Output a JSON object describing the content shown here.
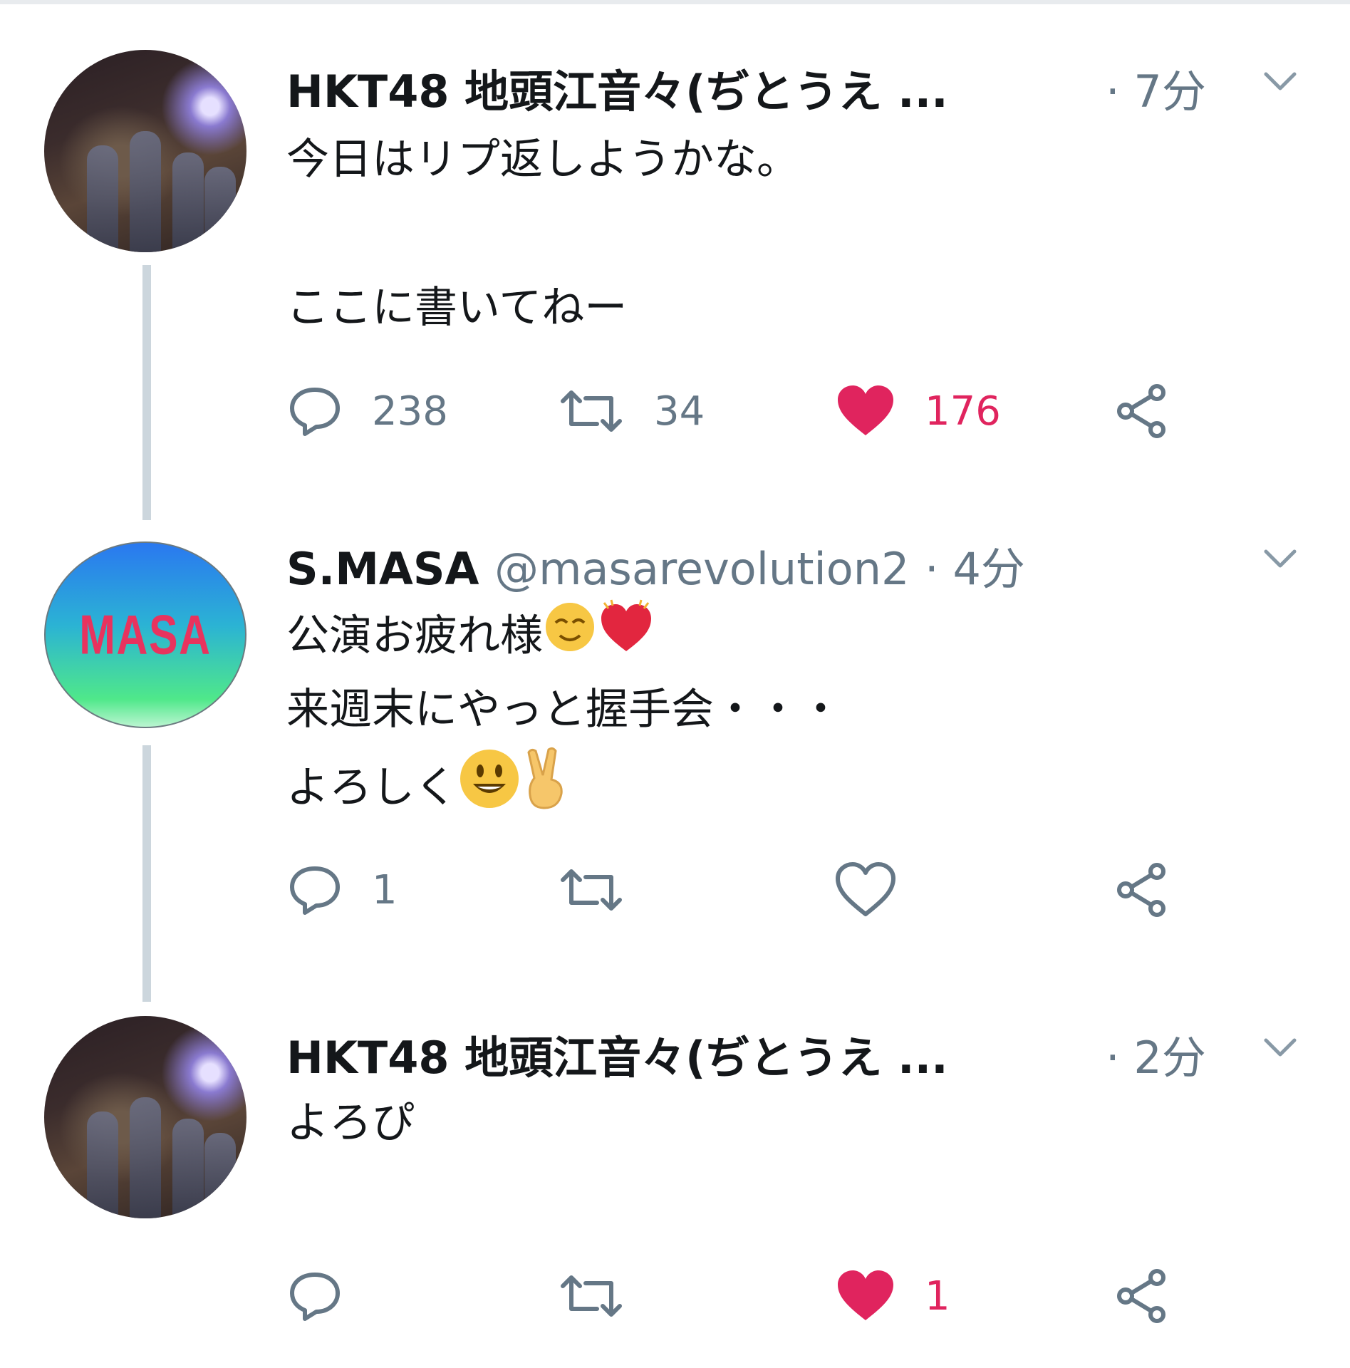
{
  "tweets": [
    {
      "name": "HKT48 地頭江音々(ぢとうえ ...",
      "handle": "",
      "time": "· 7分",
      "body": [
        "今日はリプ返しようかな。",
        "",
        "ここに書いてねー"
      ],
      "reply_count": "238",
      "retweet_count": "34",
      "like_count": "176",
      "liked": true
    },
    {
      "name": "S.MASA",
      "handle": "@masarevolution2",
      "time": "· 4分",
      "body": [
        "公演お疲れ様",
        "来週末にやっと握手会・・・",
        "よろしく"
      ],
      "avatar_text": "MASA",
      "reply_count": "1",
      "retweet_count": "",
      "like_count": "",
      "liked": false
    },
    {
      "name": "HKT48 地頭江音々(ぢとうえ ...",
      "handle": "",
      "time": "· 2分",
      "body": [
        "よろぴ"
      ],
      "reply_count": "",
      "retweet_count": "",
      "like_count": "1",
      "liked": true
    }
  ],
  "colors": {
    "text": "#14171a",
    "secondary": "#657786",
    "like": "#e0245e",
    "thread_line": "#ccd6dd"
  },
  "icons": [
    "reply-icon",
    "retweet-icon",
    "like-icon",
    "share-icon",
    "chevron-down-icon"
  ]
}
